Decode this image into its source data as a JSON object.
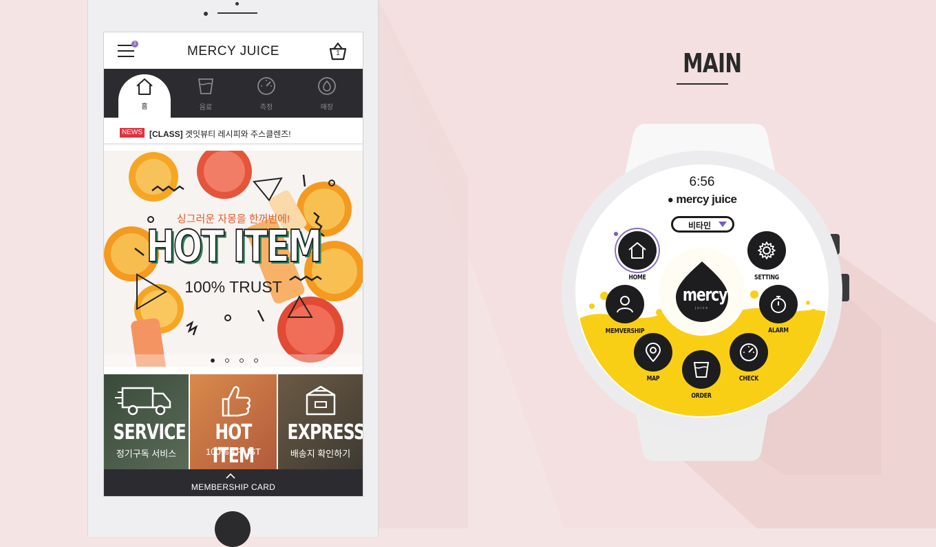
{
  "app": {
    "title": "MERCY JUICE",
    "menu_badge": "1",
    "cart_count": "1"
  },
  "tabs": [
    {
      "label": "홈",
      "icon": "home-icon",
      "active": true
    },
    {
      "label": "음료",
      "icon": "cup-icon",
      "active": false
    },
    {
      "label": "측정",
      "icon": "gauge-icon",
      "active": false
    },
    {
      "label": "매장",
      "icon": "location-icon",
      "active": false
    }
  ],
  "news": {
    "badge": "NEWS",
    "tag": "[CLASS]",
    "text": "겟잇뷰티 레시피와 주스클렌즈!"
  },
  "hero": {
    "subtitle": "싱그러운 자몽을 한꺼번에!",
    "title": "HOT ITEM",
    "tagline": "100% TRUST",
    "slides": 4,
    "current_slide": 1
  },
  "tiles": [
    {
      "title": "SERVICE",
      "subtitle": "정기구독 서비스",
      "icon": "truck-icon"
    },
    {
      "title": "HOT ITEM",
      "subtitle": "100% TRUST",
      "icon": "thumbs-up-icon"
    },
    {
      "title": "EXPRESS",
      "subtitle": "배송지 확인하기",
      "icon": "package-icon"
    }
  ],
  "membership": {
    "label": "MEMBERSHIP CARD"
  },
  "section": {
    "title": "MAIN"
  },
  "watch": {
    "time": "6:56",
    "brand": "mercy juice",
    "select_value": "비타민",
    "center_logo": "mercy",
    "center_logo_sub": "juice",
    "buttons": {
      "home": "HOME",
      "setting": "SETTING",
      "membership": "MEMVERSHIP",
      "alarm": "ALARM",
      "map": "MAP",
      "order": "ORDER",
      "check": "CHECK"
    }
  },
  "colors": {
    "background": "#f5e4e4",
    "dark": "#2c2c30",
    "accent_purple": "#8b6fc4",
    "news_red": "#e1313f",
    "watch_yellow": "#f9cf16"
  }
}
